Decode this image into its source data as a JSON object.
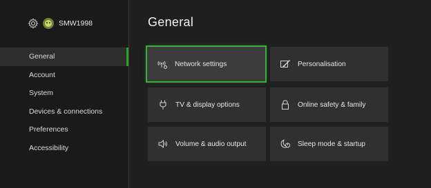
{
  "profile": {
    "gamertag": "SMW1998",
    "settings_icon": "gear-icon",
    "avatar_icon": "avatar"
  },
  "sidebar": {
    "items": [
      {
        "label": "General",
        "active": true
      },
      {
        "label": "Account",
        "active": false
      },
      {
        "label": "System",
        "active": false
      },
      {
        "label": "Devices & connections",
        "active": false
      },
      {
        "label": "Preferences",
        "active": false
      },
      {
        "label": "Accessibility",
        "active": false
      }
    ]
  },
  "main": {
    "title": "General",
    "tiles": [
      {
        "label": "Network settings",
        "icon": "network-icon",
        "focused": true
      },
      {
        "label": "Personalisation",
        "icon": "personalisation-icon",
        "focused": false
      },
      {
        "label": "TV & display options",
        "icon": "tv-plug-icon",
        "focused": false
      },
      {
        "label": "Online safety & family",
        "icon": "lock-icon",
        "focused": false
      },
      {
        "label": "Volume & audio output",
        "icon": "speaker-icon",
        "focused": false
      },
      {
        "label": "Sleep mode & startup",
        "icon": "sleep-power-icon",
        "focused": false
      }
    ]
  },
  "colors": {
    "accent": "#39b039",
    "background": "#1f1f1f",
    "tile": "#303030"
  }
}
